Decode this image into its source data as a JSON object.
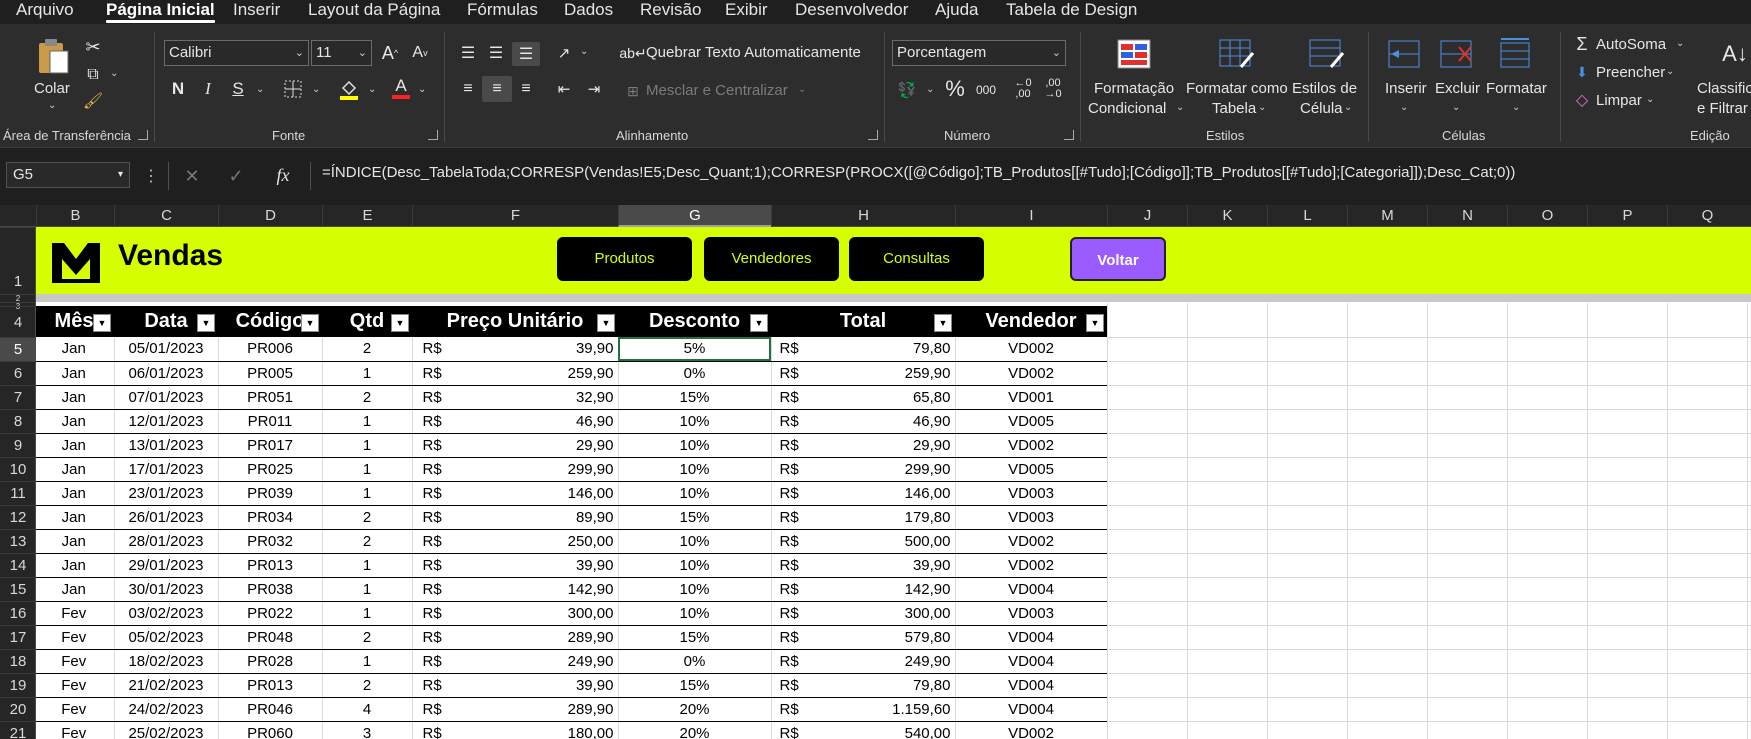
{
  "menu": {
    "tabs": [
      "Arquivo",
      "Página Inicial",
      "Inserir",
      "Layout da Página",
      "Fórmulas",
      "Dados",
      "Revisão",
      "Exibir",
      "Desenvolvedor",
      "Ajuda",
      "Tabela de Design"
    ],
    "active": "Página Inicial"
  },
  "ribbon": {
    "clipboard": {
      "paste": "Colar",
      "label": "Área de Transferência"
    },
    "font": {
      "name": "Calibri",
      "size": "11",
      "bold": "N",
      "italic": "I",
      "underline": "S",
      "label": "Fonte"
    },
    "alignment": {
      "wrap": "Quebrar Texto Automaticamente",
      "merge": "Mesclar e Centralizar",
      "label": "Alinhamento"
    },
    "number": {
      "format": "Porcentagem",
      "percent": "%",
      "thousands": "000",
      "label": "Número"
    },
    "styles": {
      "conditional": [
        "Formatação",
        "Condicional"
      ],
      "table": [
        "Formatar como",
        "Tabela"
      ],
      "cell": [
        "Estilos de",
        "Célula"
      ],
      "label": "Estilos"
    },
    "cells": {
      "insert": "Inserir",
      "delete": "Excluir",
      "format": "Formatar",
      "label": "Células"
    },
    "editing": {
      "autosum": "AutoSoma",
      "fill": "Preencher",
      "clear": "Limpar",
      "sort": [
        "Classific",
        "e Filtrar"
      ],
      "label": "Edição"
    }
  },
  "formula_bar": {
    "name_box": "G5",
    "fx": "fx",
    "formula": "=ÍNDICE(Desc_TabelaToda;CORRESP(Vendas!E5;Desc_Quant;1);CORRESP(PROCX([@Código];TB_Produtos[[#Tudo];[Código]];TB_Produtos[[#Tudo];[Categoria]]);Desc_Cat;0))"
  },
  "columns": [
    "B",
    "C",
    "D",
    "E",
    "F",
    "G",
    "H",
    "I",
    "J",
    "K",
    "L",
    "M",
    "N",
    "O",
    "P",
    "Q"
  ],
  "selected_column": "G",
  "rows": [
    "1",
    "2",
    "3",
    "4",
    "5",
    "6",
    "7",
    "8",
    "9",
    "10",
    "11",
    "12",
    "13",
    "14",
    "15",
    "16",
    "17",
    "18",
    "19",
    "20",
    "21"
  ],
  "selected_row": "5",
  "banner": {
    "logo": "M",
    "title": "Vendas",
    "buttons": [
      "Produtos",
      "Vendedores",
      "Consultas"
    ],
    "back": "Voltar",
    "colors": {
      "banner": "#d6ff00",
      "button": "#000000",
      "back": "#9b5cff"
    }
  },
  "table": {
    "headers": [
      "Mês",
      "Data",
      "Código",
      "Qtd",
      "Preço Unitário",
      "Desconto",
      "Total",
      "Vendedor"
    ],
    "currency": "R$",
    "rows": [
      [
        "Jan",
        "05/01/2023",
        "PR006",
        "2",
        "39,90",
        "5%",
        "79,80",
        "VD002"
      ],
      [
        "Jan",
        "06/01/2023",
        "PR005",
        "1",
        "259,90",
        "0%",
        "259,90",
        "VD002"
      ],
      [
        "Jan",
        "07/01/2023",
        "PR051",
        "2",
        "32,90",
        "15%",
        "65,80",
        "VD001"
      ],
      [
        "Jan",
        "12/01/2023",
        "PR011",
        "1",
        "46,90",
        "10%",
        "46,90",
        "VD005"
      ],
      [
        "Jan",
        "13/01/2023",
        "PR017",
        "1",
        "29,90",
        "10%",
        "29,90",
        "VD002"
      ],
      [
        "Jan",
        "17/01/2023",
        "PR025",
        "1",
        "299,90",
        "10%",
        "299,90",
        "VD005"
      ],
      [
        "Jan",
        "23/01/2023",
        "PR039",
        "1",
        "146,00",
        "10%",
        "146,00",
        "VD003"
      ],
      [
        "Jan",
        "26/01/2023",
        "PR034",
        "2",
        "89,90",
        "15%",
        "179,80",
        "VD003"
      ],
      [
        "Jan",
        "28/01/2023",
        "PR032",
        "2",
        "250,00",
        "10%",
        "500,00",
        "VD002"
      ],
      [
        "Jan",
        "29/01/2023",
        "PR013",
        "1",
        "39,90",
        "10%",
        "39,90",
        "VD002"
      ],
      [
        "Jan",
        "30/01/2023",
        "PR038",
        "1",
        "142,90",
        "10%",
        "142,90",
        "VD004"
      ],
      [
        "Fev",
        "03/02/2023",
        "PR022",
        "1",
        "300,00",
        "10%",
        "300,00",
        "VD003"
      ],
      [
        "Fev",
        "05/02/2023",
        "PR048",
        "2",
        "289,90",
        "15%",
        "579,80",
        "VD004"
      ],
      [
        "Fev",
        "18/02/2023",
        "PR028",
        "1",
        "249,90",
        "0%",
        "249,90",
        "VD004"
      ],
      [
        "Fev",
        "21/02/2023",
        "PR013",
        "2",
        "39,90",
        "15%",
        "79,80",
        "VD004"
      ],
      [
        "Fev",
        "24/02/2023",
        "PR046",
        "4",
        "289,90",
        "20%",
        "1.159,60",
        "VD004"
      ],
      [
        "Fev",
        "25/02/2023",
        "PR060",
        "3",
        "180,00",
        "20%",
        "540,00",
        "VD002"
      ]
    ]
  }
}
